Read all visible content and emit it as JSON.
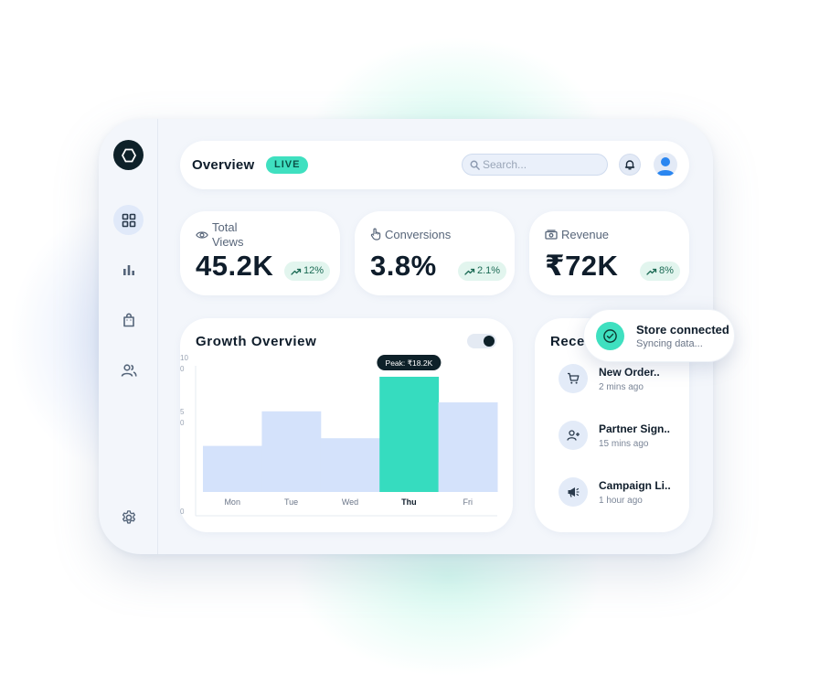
{
  "header": {
    "title": "Overview",
    "live_badge": "LIVE",
    "search_placeholder": "Search..."
  },
  "sidebar": {
    "items": [
      {
        "name": "dashboard",
        "icon": "grid-icon",
        "active": true
      },
      {
        "name": "analytics",
        "icon": "bar-chart-icon",
        "active": false
      },
      {
        "name": "products",
        "icon": "shopping-bag-icon",
        "active": false
      },
      {
        "name": "users",
        "icon": "users-icon",
        "active": false
      },
      {
        "name": "settings",
        "icon": "gear-icon",
        "active": false
      }
    ]
  },
  "kpis": [
    {
      "label": "Total\nViews",
      "value": "45.2K",
      "change": "12%",
      "icon": "eye-icon"
    },
    {
      "label": "Conversions",
      "value": "3.8%",
      "change": "2.1%",
      "icon": "pointer-icon"
    },
    {
      "label": "Revenue",
      "value": "₹72K",
      "change": "8%",
      "icon": "cash-icon"
    }
  ],
  "growth": {
    "title": "Growth Overview"
  },
  "chart_data": {
    "type": "bar",
    "categories": [
      "Mon",
      "Tue",
      "Wed",
      "Thu",
      "Fri"
    ],
    "values": [
      36,
      63,
      42,
      90,
      70
    ],
    "highlight_index": 3,
    "highlight_label": "Peak: ₹18.2K",
    "ytick_labels": [
      "10\n0",
      "5\n0",
      "0"
    ],
    "ylim": [
      0,
      100
    ],
    "colors": {
      "bar": "#d4e2fb",
      "highlight": "#36dcbf",
      "tooltip": "#0e2129"
    }
  },
  "activity": {
    "title": "Recent Activity",
    "items": [
      {
        "name": "New Order..",
        "time": "2 mins ago",
        "icon": "cart-icon"
      },
      {
        "name": "Partner Sign..",
        "time": "15 mins ago",
        "icon": "user-plus-icon"
      },
      {
        "name": "Campaign Li..",
        "time": "1 hour ago",
        "icon": "megaphone-icon"
      }
    ]
  },
  "toast": {
    "title": "Store connected",
    "subtitle": "Syncing data..."
  },
  "colors": {
    "accent": "#3fe0c0",
    "dark": "#0e2129",
    "badge_bg": "#e2f5ee",
    "badge_text": "#1c6b55"
  }
}
